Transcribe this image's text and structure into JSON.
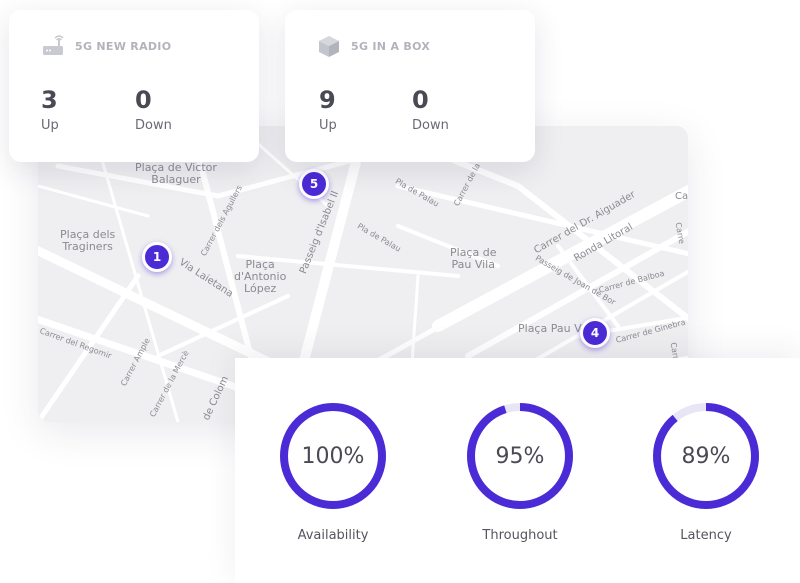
{
  "colors": {
    "accent": "#4b2bd6",
    "track": "#e8e6f5",
    "map_bg": "#efeff1"
  },
  "cards": [
    {
      "icon": "router-icon",
      "title": "5G NEW RADIO",
      "stats": [
        {
          "value": "3",
          "label": "Up"
        },
        {
          "value": "0",
          "label": "Down"
        }
      ]
    },
    {
      "icon": "box-icon",
      "title": "5G IN A BOX",
      "stats": [
        {
          "value": "9",
          "label": "Up"
        },
        {
          "value": "0",
          "label": "Down"
        }
      ]
    }
  ],
  "map": {
    "places": [
      {
        "text": "Plaça de Victor\nBalaguer"
      },
      {
        "text": "Plaça dels\nTraginers"
      },
      {
        "text": "Plaça\nd'Antonio\nLópez"
      },
      {
        "text": "Plaça de\nPau Vila"
      },
      {
        "text": "Plaça Pau Vi"
      }
    ],
    "streets": [
      "Via Laietana",
      "Carrer dels Agullers",
      "Passeig d'Isabel II",
      "Pla de Palau",
      "Pla de Palau",
      "Carrer de la R",
      "Carrer del Dr. Aiguader",
      "Ronda Litoral",
      "Passeig de Joan de Bor",
      "Carrer de Balboa",
      "Carrer de Ginebra",
      "Carrer del Regomir",
      "Carrer Ample",
      "Carrer de la Mercè",
      "g de Colom",
      "Ca",
      "Carre",
      "Carre"
    ],
    "pins": [
      "1",
      "5",
      "4"
    ]
  },
  "metrics": [
    {
      "value": "100%",
      "label": "Availability",
      "fraction": 1.0
    },
    {
      "value": "95%",
      "label": "Throughout",
      "fraction": 0.95
    },
    {
      "value": "89%",
      "label": "Latency",
      "fraction": 0.89
    }
  ]
}
